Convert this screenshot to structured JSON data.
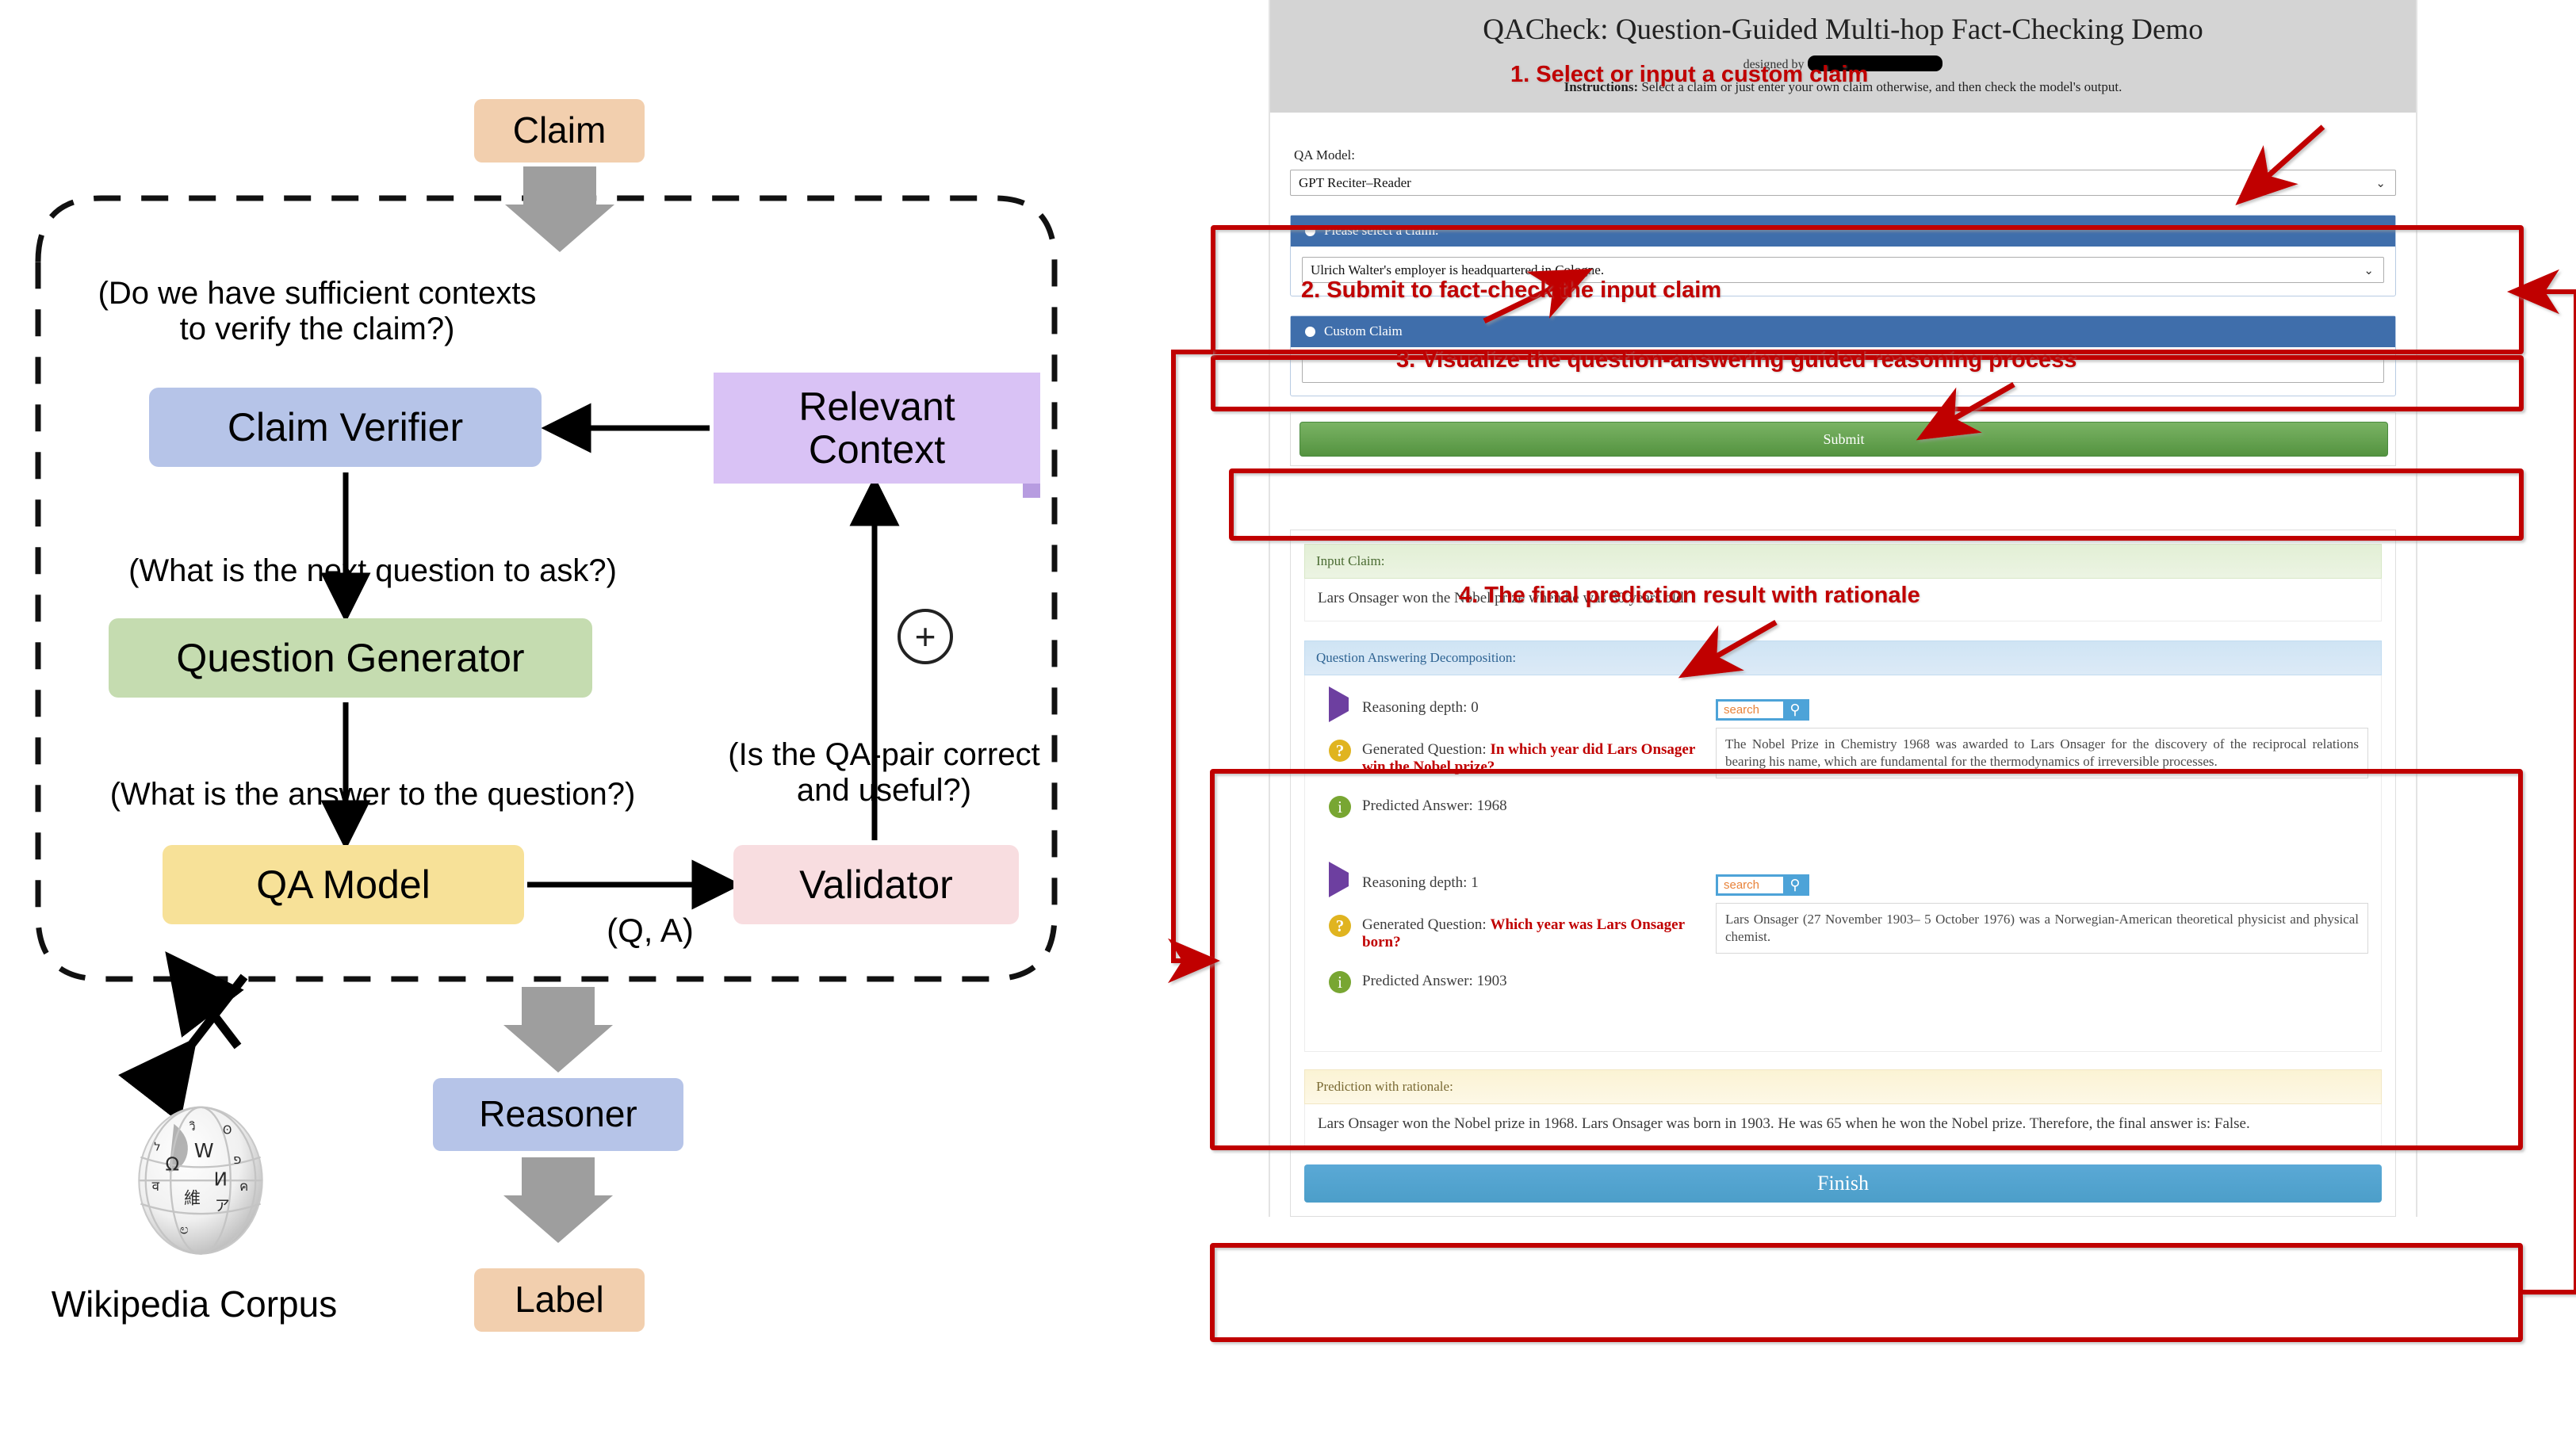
{
  "diagram": {
    "nodes": {
      "claim": "Claim",
      "claim_verifier": "Claim Verifier",
      "question_generator": "Question Generator",
      "qa_model": "QA Model",
      "validator": "Validator",
      "relevant_context_line1": "Relevant",
      "relevant_context_line2": "Context",
      "reasoner": "Reasoner",
      "label": "Label",
      "wikipedia_corpus": "Wikipedia Corpus",
      "plus": "+"
    },
    "edge_labels": {
      "sufficient_contexts": "(Do we have sufficient contexts to verify the claim?)",
      "next_question": "(What is the next question to ask?)",
      "answer_to_question": "(What is the answer to the question?)",
      "qa_pair_valid": "(Is the QA-pair correct and useful?)",
      "qa_tuple": "(Q, A)"
    },
    "colors": {
      "claim": "#f2cfae",
      "verifier": "#b6c4e8",
      "generator": "#c5dcb0",
      "qa_model": "#f7e198",
      "validator": "#f8dde0",
      "context": "#d9c2f5",
      "arrow_gray": "#9e9e9e"
    }
  },
  "app": {
    "header": {
      "title": "QACheck: Question-Guided Multi-hop Fact-Checking Demo",
      "designed_by": "designed by",
      "instructions_label": "Instructions:",
      "instructions_text": "Select a claim or just enter your own claim otherwise, and then check the model's output."
    },
    "qa_model": {
      "label": "QA Model:",
      "value": "GPT Reciter–Reader",
      "caret": "⌄"
    },
    "select_claim": {
      "header": "Please select a claim.",
      "value": "Ulrich Walter's employer is headquartered in Cologne.",
      "caret": "⌄"
    },
    "custom_claim": {
      "header": "Custom Claim",
      "value": "",
      "placeholder": ""
    },
    "submit_label": "Submit",
    "finish_label": "Finish",
    "result": {
      "input_claim_label": "Input Claim:",
      "input_claim_text": "Lars Onsager won the Nobel prize when he was 30 years old.",
      "decomposition_label": "Question Answering Decomposition:",
      "prediction_label": "Prediction with rationale:",
      "prediction_text": "Lars Onsager won the Nobel prize in 1968. Lars Onsager was born in 1903. He was 65 when he won the Nobel prize. Therefore, the final answer is: False.",
      "search_placeholder": "search",
      "hops": [
        {
          "depth_label": "Reasoning depth: 0",
          "question_label": "Generated Question:",
          "question_text": "In which year did Lars Onsager  win the Nobel prize?",
          "answer_label": "Predicted Answer: 1968",
          "evidence": "The Nobel Prize in Chemistry 1968 was awarded to Lars Onsager for the discovery of the reciprocal relations bearing his name, which are fundamental for the thermodynamics of irreversible processes."
        },
        {
          "depth_label": "Reasoning depth: 1",
          "question_label": "Generated Question:",
          "question_text": "Which year was Lars Onsager born?",
          "answer_label": "Predicted Answer: 1903",
          "evidence": "Lars Onsager (27 November 1903– 5 October 1976) was a Norwegian-American theoretical physicist and physical chemist."
        }
      ]
    }
  },
  "annotations": {
    "step1": "1. Select or input a custom claim",
    "step2": "2. Submit to fact-check the input claim",
    "step3": "3. Visualize the question-answering guided reasoning process",
    "step4": "4. The final prediction result with rationale",
    "color": "#c00000"
  }
}
